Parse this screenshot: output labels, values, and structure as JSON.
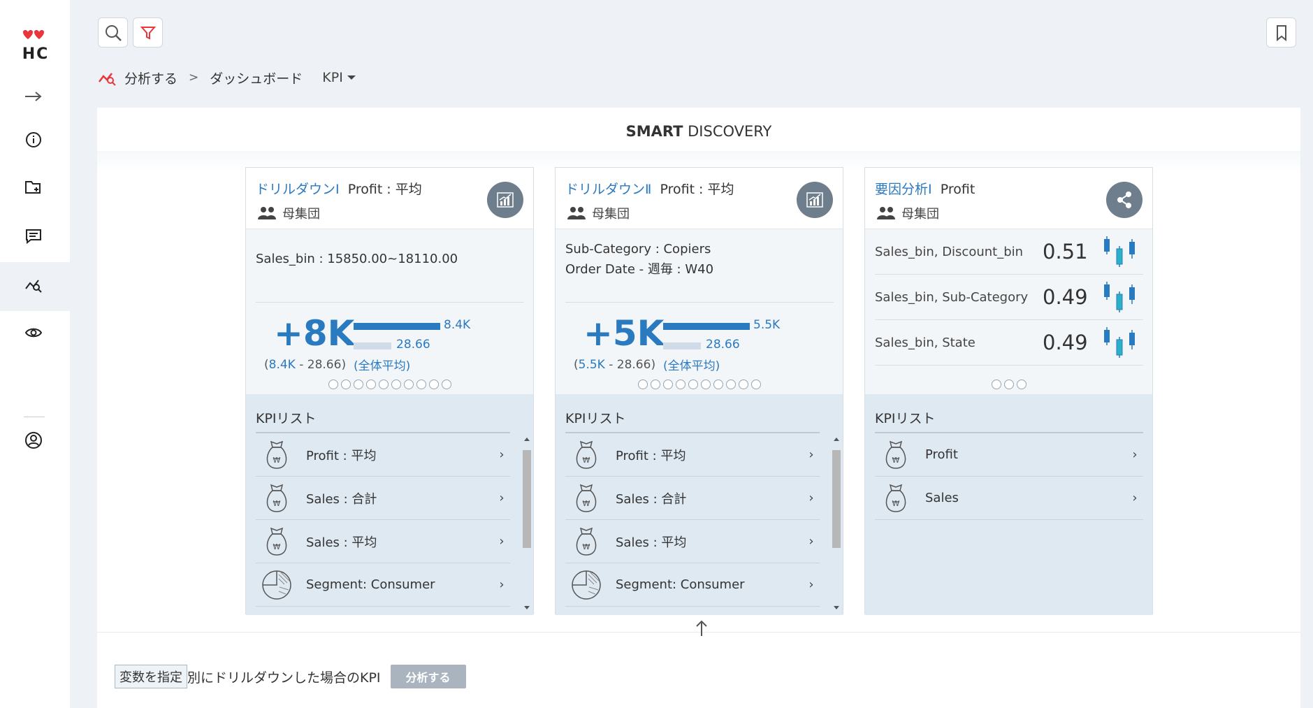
{
  "sidebar": {
    "logo_text": "HC",
    "items": [
      {
        "name": "expand",
        "icon": "arrow-right-icon"
      },
      {
        "name": "info",
        "icon": "info-icon"
      },
      {
        "name": "add-folder",
        "icon": "folder-plus-icon"
      },
      {
        "name": "comments",
        "icon": "comment-icon"
      },
      {
        "name": "analyze",
        "icon": "analyze-icon",
        "active": true
      },
      {
        "name": "view",
        "icon": "eye-icon"
      },
      {
        "name": "account",
        "icon": "user-circle-icon"
      }
    ]
  },
  "toolbar": {
    "search_icon": "search-icon",
    "filter_icon": "filter-icon",
    "bookmark_icon": "bookmark-icon"
  },
  "breadcrumb": {
    "root": "分析する",
    "separator": ">",
    "current": "ダッシュボード",
    "dropdown": "KPI"
  },
  "main": {
    "title_bold": "SMART",
    "title_rest": "DISCOVERY"
  },
  "cards": [
    {
      "title_accent": "ドリルダウンⅠ",
      "title_rest": "Profit : 平均",
      "population": "母集団",
      "condition_lines": [
        "Sales_bin : 15850.00~18110.00"
      ],
      "big_value": "+8K",
      "sub_open": "(",
      "sub_value": "8.4K",
      "sub_rest": " - 28.66)",
      "bar_value_label": "8.4K",
      "bar_avg_label": "28.66",
      "avg_caption": "(全体平均)",
      "dots": 10,
      "kpi_title": "KPIリスト",
      "kpi_items": [
        "Profit : 平均",
        "Sales : 合計",
        "Sales : 平均",
        "Segment: Consumer"
      ]
    },
    {
      "title_accent": "ドリルダウンⅡ",
      "title_rest": "Profit : 平均",
      "population": "母集団",
      "condition_lines": [
        "Sub-Category : Copiers",
        "Order Date - 週毎 : W40"
      ],
      "big_value": "+5K",
      "sub_open": "(",
      "sub_value": "5.5K",
      "sub_rest": " - 28.66)",
      "bar_value_label": "5.5K",
      "bar_avg_label": "28.66",
      "avg_caption": "(全体平均)",
      "dots": 10,
      "kpi_title": "KPIリスト",
      "kpi_items": [
        "Profit : 平均",
        "Sales : 合計",
        "Sales : 平均",
        "Segment: Consumer"
      ]
    },
    {
      "title_accent": "要因分析Ⅰ",
      "title_rest": "Profit",
      "population": "母集団",
      "factors": [
        {
          "name": "Sales_bin, Discount_bin",
          "value": "0.51"
        },
        {
          "name": "Sales_bin, Sub-Category",
          "value": "0.49"
        },
        {
          "name": "Sales_bin, State",
          "value": "0.49"
        }
      ],
      "dots": 3,
      "kpi_title": "KPIリスト",
      "kpi_items": [
        "Profit",
        "Sales"
      ]
    }
  ],
  "bottom": {
    "var_button": "変数を指定",
    "text": "別にドリルダウンした場合のKPI",
    "run_button": "分析する"
  },
  "colors": {
    "accent": "#2a7ac0",
    "brand": "#e8363c",
    "badge": "#6e7e8c"
  }
}
